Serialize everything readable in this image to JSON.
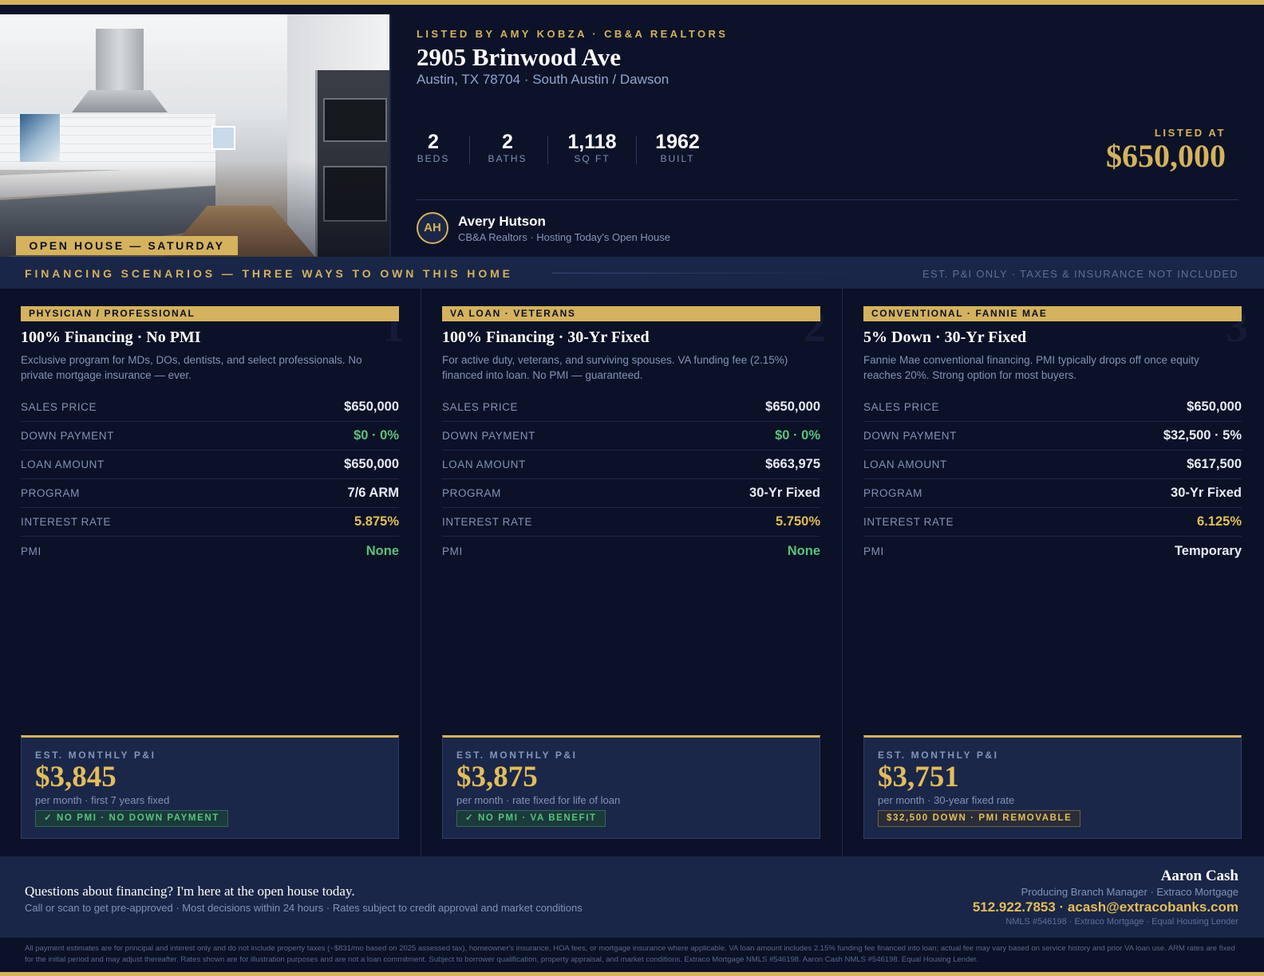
{
  "header": {
    "photo_badge": "OPEN HOUSE — SATURDAY",
    "listed_by": "LISTED BY AMY KOBZA · CB&A REALTORS",
    "address": "2905 Brinwood Ave",
    "city_line": "Austin, TX 78704 · South Austin / Dawson",
    "stats": [
      {
        "num": "2",
        "label": "BEDS"
      },
      {
        "num": "2",
        "label": "BATHS"
      },
      {
        "num": "1,118",
        "label": "SQ FT"
      },
      {
        "num": "1962",
        "label": "BUILT"
      }
    ],
    "listed_at_label": "LISTED AT",
    "listed_at_price": "$650,000",
    "host": {
      "initials": "AH",
      "name": "Avery Hutson",
      "subtitle": "CB&A Realtors · Hosting Today's Open House"
    }
  },
  "band": {
    "title": "FINANCING SCENARIOS — THREE WAYS TO OWN THIS HOME",
    "note": "EST. P&I ONLY · TAXES & INSURANCE NOT INCLUDED"
  },
  "cards": [
    {
      "number": "1",
      "tag": "PHYSICIAN / PROFESSIONAL",
      "title": "100% Financing · No PMI",
      "desc": "Exclusive program for MDs, DOs, dentists, and select professionals. No private mortgage insurance — ever.",
      "rows": [
        {
          "k": "SALES PRICE",
          "v": "$650,000",
          "tone": ""
        },
        {
          "k": "DOWN PAYMENT",
          "v": "$0 · 0%",
          "tone": "green"
        },
        {
          "k": "LOAN AMOUNT",
          "v": "$650,000",
          "tone": ""
        },
        {
          "k": "PROGRAM",
          "v": "7/6 ARM",
          "tone": ""
        },
        {
          "k": "INTEREST RATE",
          "v": "5.875%",
          "tone": "gold"
        },
        {
          "k": "PMI",
          "v": "None",
          "tone": "green"
        }
      ],
      "pay_label": "EST. MONTHLY P&I",
      "pay_amount": "$3,845",
      "pay_sub": "per month · first 7 years fixed",
      "pay_badge": "✓ NO PMI · NO DOWN PAYMENT",
      "pay_badge_tone": "green"
    },
    {
      "number": "2",
      "tag": "VA LOAN · VETERANS",
      "title": "100% Financing · 30-Yr Fixed",
      "desc": "For active duty, veterans, and surviving spouses. VA funding fee (2.15%) financed into loan. No PMI — guaranteed.",
      "rows": [
        {
          "k": "SALES PRICE",
          "v": "$650,000",
          "tone": ""
        },
        {
          "k": "DOWN PAYMENT",
          "v": "$0 · 0%",
          "tone": "green"
        },
        {
          "k": "LOAN AMOUNT",
          "v": "$663,975",
          "tone": ""
        },
        {
          "k": "PROGRAM",
          "v": "30-Yr Fixed",
          "tone": ""
        },
        {
          "k": "INTEREST RATE",
          "v": "5.750%",
          "tone": "gold"
        },
        {
          "k": "PMI",
          "v": "None",
          "tone": "green"
        }
      ],
      "pay_label": "EST. MONTHLY P&I",
      "pay_amount": "$3,875",
      "pay_sub": "per month · rate fixed for life of loan",
      "pay_badge": "✓ NO PMI · VA BENEFIT",
      "pay_badge_tone": "green"
    },
    {
      "number": "3",
      "tag": "CONVENTIONAL · FANNIE MAE",
      "title": "5% Down · 30-Yr Fixed",
      "desc": "Fannie Mae conventional financing. PMI typically drops off once equity reaches 20%. Strong option for most buyers.",
      "rows": [
        {
          "k": "SALES PRICE",
          "v": "$650,000",
          "tone": ""
        },
        {
          "k": "DOWN PAYMENT",
          "v": "$32,500 · 5%",
          "tone": ""
        },
        {
          "k": "LOAN AMOUNT",
          "v": "$617,500",
          "tone": ""
        },
        {
          "k": "PROGRAM",
          "v": "30-Yr Fixed",
          "tone": ""
        },
        {
          "k": "INTEREST RATE",
          "v": "6.125%",
          "tone": "gold"
        },
        {
          "k": "PMI",
          "v": "Temporary",
          "tone": ""
        }
      ],
      "pay_label": "EST. MONTHLY P&I",
      "pay_amount": "$3,751",
      "pay_sub": "per month · 30-year fixed rate",
      "pay_badge": "$32,500 DOWN · PMI REMOVABLE",
      "pay_badge_tone": "gold"
    }
  ],
  "footer": {
    "question": "Questions about financing? I'm here at the open house today.",
    "sub": "Call or scan to get pre-approved · Most decisions within 24 hours · Rates subject to credit approval and market conditions",
    "name": "Aaron Cash",
    "role": "Producing Branch Manager · Extraco Mortgage",
    "contact": "512.922.7853 · acash@extracobanks.com",
    "nmls": "NMLS #546198 · Extraco Mortgage · Equal Housing Lender"
  },
  "disclaimer": "All payment estimates are for principal and interest only and do not include property taxes (~$831/mo based on 2025 assessed tax), homeowner's insurance, HOA fees, or mortgage insurance where applicable. VA loan amount includes 2.15% funding fee financed into loan; actual fee may vary based on service history and prior VA loan use. ARM rates are fixed for the initial period and may adjust thereafter. Rates shown are for illustration purposes and are not a loan commitment. Subject to borrower qualification, property appraisal, and market conditions. Extraco Mortgage NMLS #546198. Aaron Cash NMLS #546198. Equal Housing Lender.",
  "colors": {
    "gold": "#d4b25e",
    "navy": "#0b1126",
    "band": "#1a2647",
    "green": "#5bc17c"
  }
}
